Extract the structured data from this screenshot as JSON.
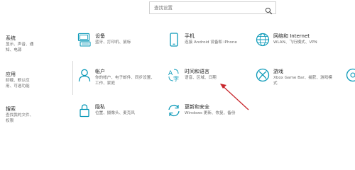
{
  "search": {
    "placeholder": "查找设置"
  },
  "tiles": [
    {
      "title": "系统",
      "desc": "显示、声音、通知、电源"
    },
    {
      "title": "设备",
      "desc": "蓝牙、打印机、鼠标"
    },
    {
      "title": "手机",
      "desc": "连接 Android 设备和 iPhone"
    },
    {
      "title": "网络和 Internet",
      "desc": "WLAN、飞行模式、VPN"
    },
    {
      "title": "应用",
      "desc": "卸载、默认应用、可选功能"
    },
    {
      "title": "帐户",
      "desc": "你的帐户、电子邮件、同步设置、工作、家庭"
    },
    {
      "title": "时间和语言",
      "desc": "语音、区域、日期"
    },
    {
      "title": "游戏",
      "desc": "Xbox Game Bar、捕获、游戏模式"
    },
    {
      "title": "搜索",
      "desc": "查找我的文件、权限"
    },
    {
      "title": "隐私",
      "desc": "位置、摄像头、麦克风"
    },
    {
      "title": "更新和安全",
      "desc": "Windows 更新、恢复、备份"
    }
  ],
  "colors": {
    "accent": "#0a99b8",
    "arrow": "#c8262c"
  }
}
